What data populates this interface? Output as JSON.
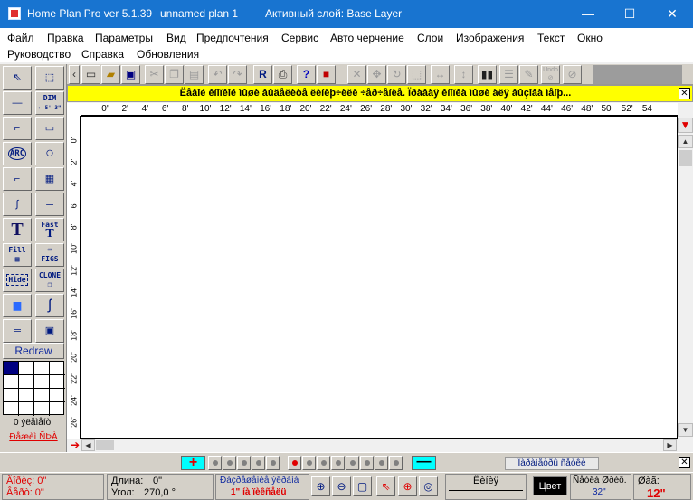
{
  "window": {
    "app_title": "Home Plan Pro ver 5.1.39",
    "plan_name": "unnamed plan 1",
    "active_layer": "Активный слой: Base Layer",
    "controls": {
      "minimize": "—",
      "maximize": "☐",
      "close": "✕"
    }
  },
  "menu": {
    "row1": [
      "Файл",
      "Правка",
      "Параметры",
      "Вид",
      "Предпочтения",
      "Сервис",
      "Авто черчение",
      "Слои",
      "Изображения",
      "Текст",
      "Окно"
    ],
    "row2": [
      "Руководство",
      "Справка",
      "Обновления"
    ]
  },
  "toolbar": {
    "undo_label": "Undo"
  },
  "left_tools": {
    "dim_label": "DIM",
    "dim_sub": "← 5' 3\" →",
    "arc_label": "ARC",
    "text_glyph": "T",
    "fast_label": "Fast",
    "fill_label": "Fill",
    "figs_label": "FIGS",
    "hide_label": "Hide",
    "clone_label": "CLONE",
    "redraw_label": "Redraw",
    "items_count": "0 ýëåìåíò.",
    "clear_selection": "Ðåæèì ÑÞÀ"
  },
  "help_bar": {
    "text": "Ëåâîé êíîïêîé ìûøè âûäåëèòå ëèíèþ÷èëè ÷åð÷åíèå. Ïðàâàÿ êíîïêà ìûøè àëÿ âûçîâà ìåíþ..."
  },
  "ruler_top": [
    "0'",
    "2'",
    "4'",
    "6'",
    "8'",
    "10'",
    "12'",
    "14'",
    "16'",
    "18'",
    "20'",
    "22'",
    "24'",
    "26'",
    "28'",
    "30'",
    "32'",
    "34'",
    "36'",
    "38'",
    "40'",
    "42'",
    "44'",
    "46'",
    "48'",
    "50'",
    "52'",
    "54"
  ],
  "ruler_left": [
    "0'",
    "2'",
    "4'",
    "6'",
    "8'",
    "10'",
    "12'",
    "14'",
    "16'",
    "18'",
    "20'",
    "22'",
    "24'",
    "26'"
  ],
  "page_bar": {
    "add_label": "+",
    "remove_label": "—",
    "pages_label": "Ïàðàìåòðû ñåòêè"
  },
  "status": {
    "cursor_x": "Ãîðèç: 0\"",
    "cursor_y": "Âåðò: 0\"",
    "length_label": "Длина:",
    "length_value": "0\"",
    "angle_label": "Угол:",
    "angle_value": "270,0 °",
    "snap_label": "Ðàçðåøåíèå ýêðàíà",
    "snap_value": "1\" íà ïèêñåëü",
    "linetype_label": "Ëèíèÿ",
    "color_label": "Цвет",
    "font_label": "Ñåòêà Øðèô.",
    "font_value": "32\"",
    "size_label": "Øàã:",
    "size_value": "12\""
  }
}
